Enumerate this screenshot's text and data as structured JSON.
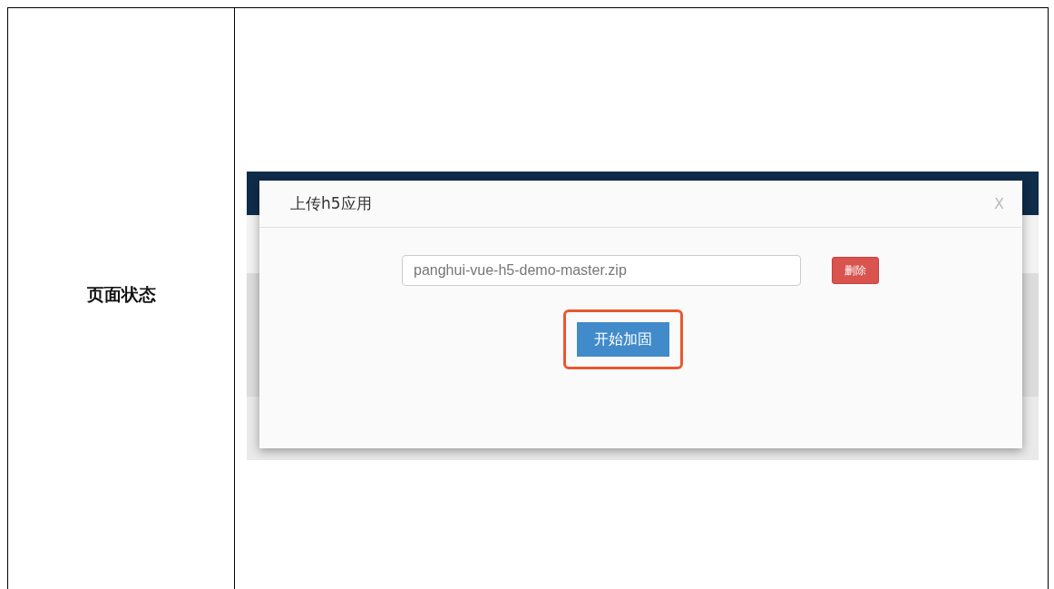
{
  "table": {
    "label": "页面状态",
    "screenshot": {
      "dialog": {
        "title": "上传h5应用",
        "close": "X",
        "file_field": {
          "value": "panghui-vue-h5-demo-master.zip"
        },
        "delete_button": "删除",
        "start_button": {
          "label": "开始加固",
          "highlighted": true
        }
      }
    }
  }
}
